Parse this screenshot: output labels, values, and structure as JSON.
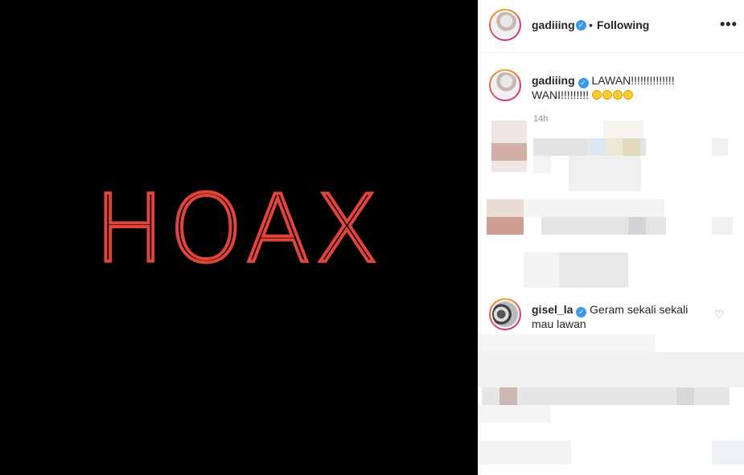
{
  "post": {
    "media": {
      "text": "HOAX",
      "text_color": "#e0443a",
      "background": "#000000"
    },
    "header": {
      "username": "gadiiing",
      "verified_icon": "verified-badge-icon",
      "separator": "•",
      "follow_status": "Following",
      "more_icon": "more-options-icon",
      "more_glyph": "•••"
    }
  },
  "caption": {
    "username": "gadiiing",
    "text_line1": "LAWAN!!!!!!!!!!!!!!",
    "text_line2": "WANI!!!!!!!!!",
    "emoji": [
      "worried-face",
      "worried-face",
      "worried-face",
      "worried-face"
    ],
    "timestamp": "14h"
  },
  "comments": [
    {
      "username": "gisel_la",
      "verified": true,
      "text": "Geram sekali sekali mau lawan",
      "like_icon": "heart-icon",
      "like_glyph": "♡"
    }
  ],
  "colors": {
    "accent": "#3897f0",
    "text": "#262626",
    "muted": "#8e8e8e",
    "divider": "#efefef"
  }
}
